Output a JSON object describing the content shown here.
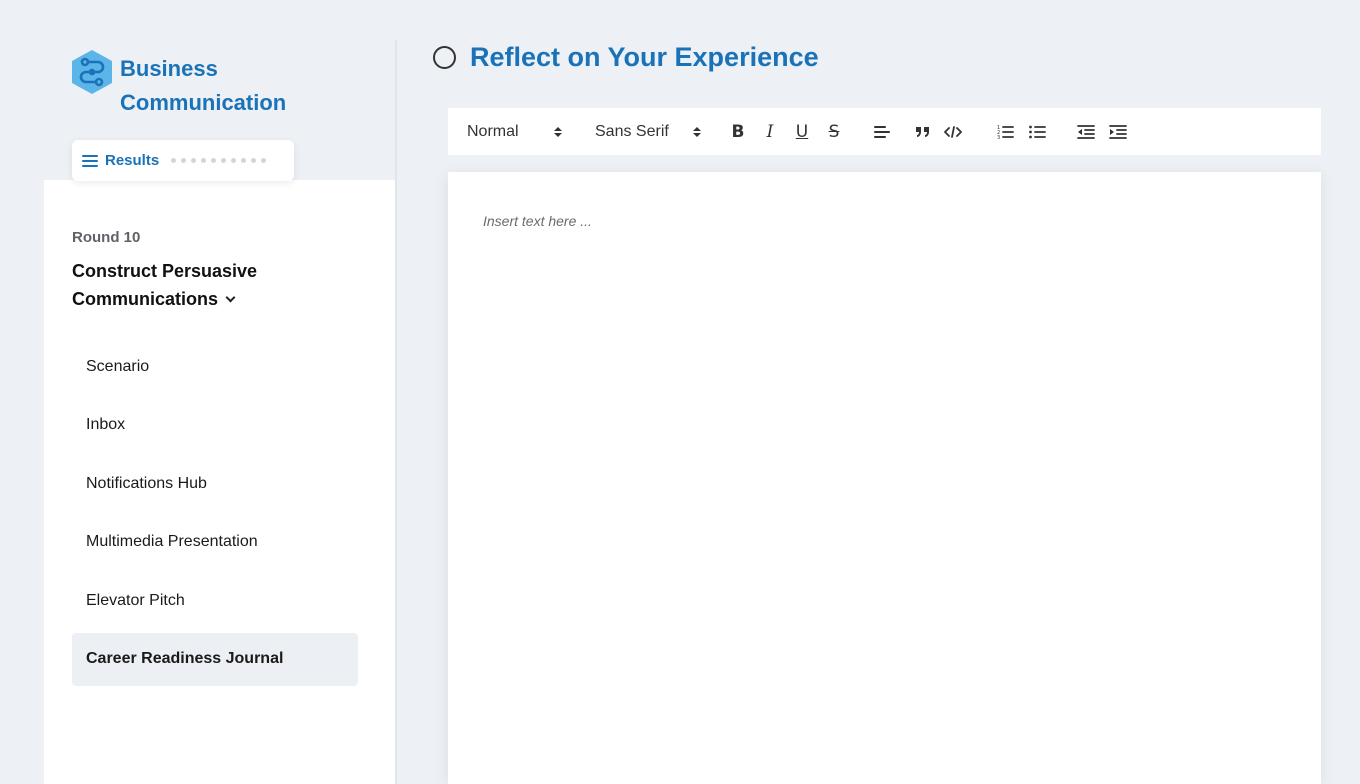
{
  "brand": {
    "line1": "Business",
    "line2": "Communication",
    "color": "#1a73b8",
    "logo_icon": "hexagon-circuit-logo-icon"
  },
  "results_button": {
    "label": "Results",
    "icon": "hamburger-menu-icon",
    "progress_dots_total": 10,
    "progress_dots_complete": 0
  },
  "module": {
    "round": "Round 10",
    "title": "Construct Persuasive Communications",
    "icon": "chevron-down-icon"
  },
  "nav": {
    "items": [
      {
        "label": "Scenario",
        "active": false
      },
      {
        "label": "Inbox",
        "active": false
      },
      {
        "label": "Notifications Hub",
        "active": false
      },
      {
        "label": "Multimedia Presentation",
        "active": false
      },
      {
        "label": "Elevator Pitch",
        "active": false
      },
      {
        "label": "Career Readiness Journal",
        "active": true
      }
    ]
  },
  "page": {
    "title": "Reflect on Your Experience",
    "status_icon": "empty-circle-icon"
  },
  "toolbar": {
    "header_select": "Normal",
    "font_select": "Sans Serif",
    "bold": "B",
    "italic": "I",
    "underline": "U",
    "strike": "S",
    "icons": [
      "bold-icon",
      "italic-icon",
      "underline-icon",
      "strikethrough-icon",
      "align-left-icon",
      "blockquote-icon",
      "code-icon",
      "ordered-list-icon",
      "bullet-list-icon",
      "outdent-icon",
      "indent-icon"
    ]
  },
  "editor": {
    "placeholder": "Insert text here ..."
  },
  "colors": {
    "accent": "#1a73b8",
    "background": "#edf0f4",
    "active_nav": "#eceff3"
  }
}
